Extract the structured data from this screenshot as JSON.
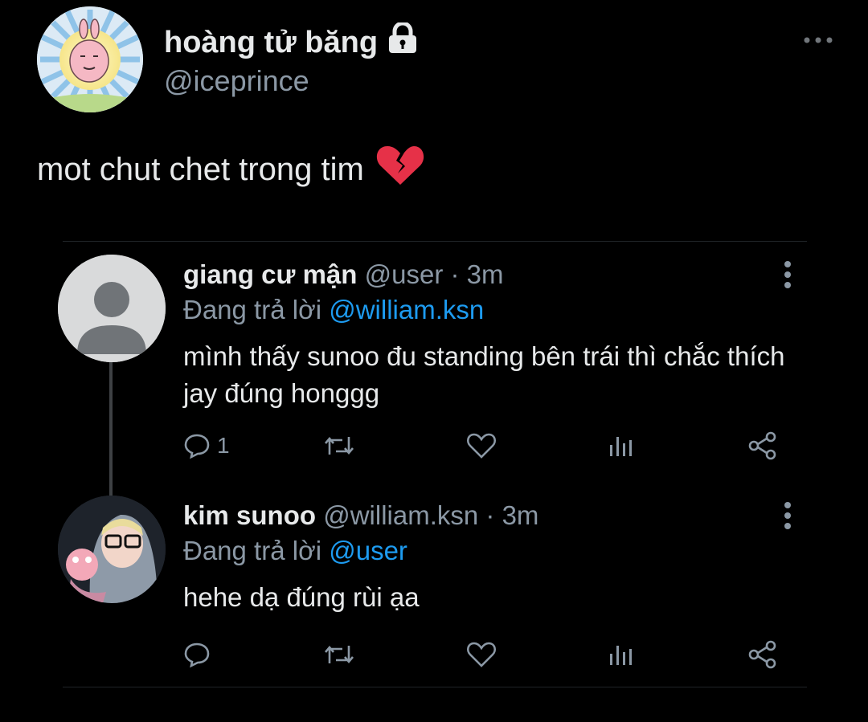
{
  "tweet": {
    "display_name": "hoàng tử băng",
    "handle": "@iceprince",
    "text": "mot chut chet trong tim",
    "emoji": "💔",
    "more_icon": "more-horizontal-icon",
    "lock_icon": "lock-icon"
  },
  "quoted_thread": {
    "replies": [
      {
        "name": "giang cư mận",
        "handle": "@user",
        "separator": "·",
        "time": "3m",
        "replying_prefix": "Đang trả lời",
        "replying_to": "@william.ksn",
        "text": "mình thấy sunoo đu standing bên trái thì chắc thích jay đúng honggg",
        "reply_count": "1"
      },
      {
        "name": "kim sunoo",
        "handle": "@william.ksn",
        "separator": "·",
        "time": "3m",
        "replying_prefix": "Đang trả lời",
        "replying_to": "@user",
        "text": "hehe dạ đúng rùi ạa",
        "reply_count": ""
      }
    ]
  },
  "colors": {
    "background": "#000000",
    "text": "#e7e9ea",
    "secondary": "#8b98a5",
    "accent": "#1d9bf0"
  }
}
